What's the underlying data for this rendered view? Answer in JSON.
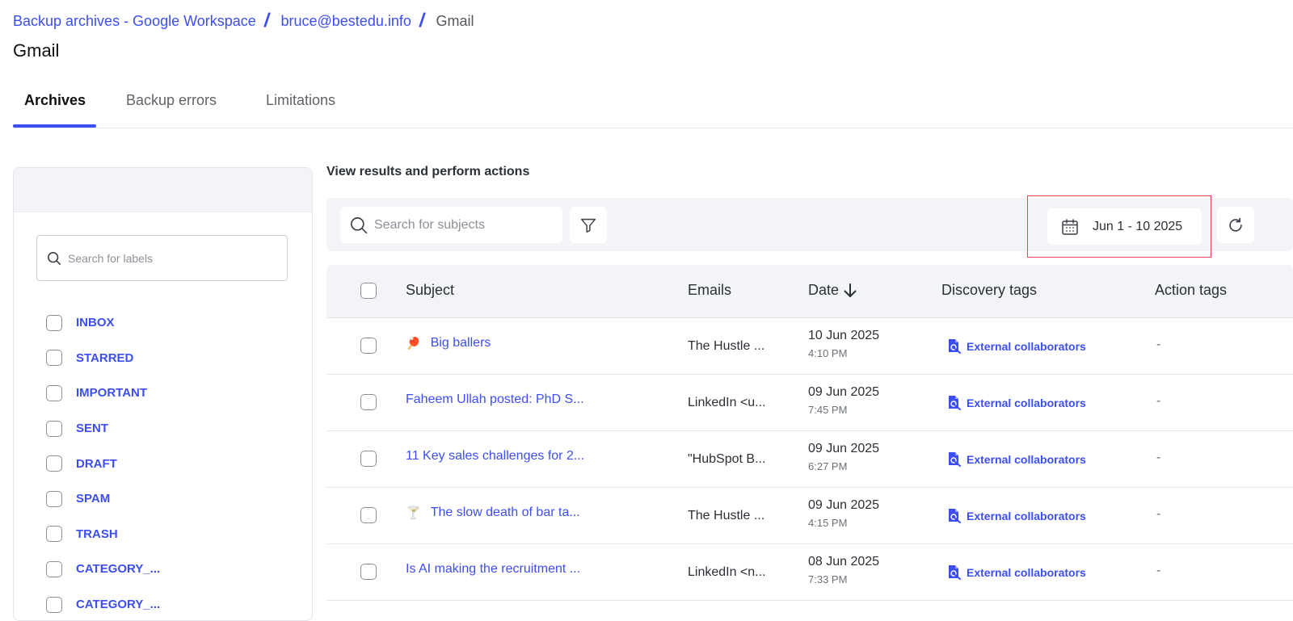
{
  "breadcrumb": {
    "items": [
      "Backup archives - Google Workspace",
      "bruce@bestedu.info"
    ],
    "separator": "/",
    "current": "Gmail"
  },
  "page": {
    "title": "Gmail"
  },
  "tabs": [
    {
      "label": "Archives",
      "active": true
    },
    {
      "label": "Backup errors",
      "active": false
    },
    {
      "label": "Limitations",
      "active": false
    }
  ],
  "sidebar": {
    "search_placeholder": "Search for labels",
    "labels": [
      "INBOX",
      "STARRED",
      "IMPORTANT",
      "SENT",
      "DRAFT",
      "SPAM",
      "TRASH",
      "CATEGORY_...",
      "CATEGORY_..."
    ]
  },
  "results": {
    "title": "View results and perform actions",
    "search_placeholder": "Search for subjects",
    "date_range": "Jun 1 - 10 2025"
  },
  "table": {
    "headers": {
      "subject": "Subject",
      "emails": "Emails",
      "date": "Date",
      "discovery": "Discovery tags",
      "action": "Action tags"
    },
    "rows": [
      {
        "emoji": "🏓",
        "subject": "Big ballers",
        "emails": "The Hustle ...",
        "date": "10 Jun 2025",
        "time": "4:10 PM",
        "tag": "External collaborators",
        "action": "-"
      },
      {
        "emoji": "",
        "subject": "Faheem Ullah posted: PhD S...",
        "emails": "LinkedIn <u...",
        "date": "09 Jun 2025",
        "time": "7:45 PM",
        "tag": "External collaborators",
        "action": "-"
      },
      {
        "emoji": "",
        "subject": "11 Key sales challenges for 2...",
        "emails": "\"HubSpot B...",
        "date": "09 Jun 2025",
        "time": "6:27 PM",
        "tag": "External collaborators",
        "action": "-"
      },
      {
        "emoji": "🍸",
        "subject": "The slow death of bar ta...",
        "emails": "The Hustle ...",
        "date": "09 Jun 2025",
        "time": "4:15 PM",
        "tag": "External collaborators",
        "action": "-"
      },
      {
        "emoji": "",
        "subject": "Is AI making the recruitment ...",
        "emails": "LinkedIn <n...",
        "date": "08 Jun 2025",
        "time": "7:33 PM",
        "tag": "External collaborators",
        "action": "-"
      }
    ]
  },
  "colors": {
    "accent": "#3d4ef0",
    "panel_bg": "#f3f4f8",
    "highlight": "#e0464a"
  },
  "icons": [
    "search-icon",
    "filter-icon",
    "calendar-icon",
    "refresh-icon",
    "sort-down-icon",
    "discovery-tag-icon"
  ]
}
